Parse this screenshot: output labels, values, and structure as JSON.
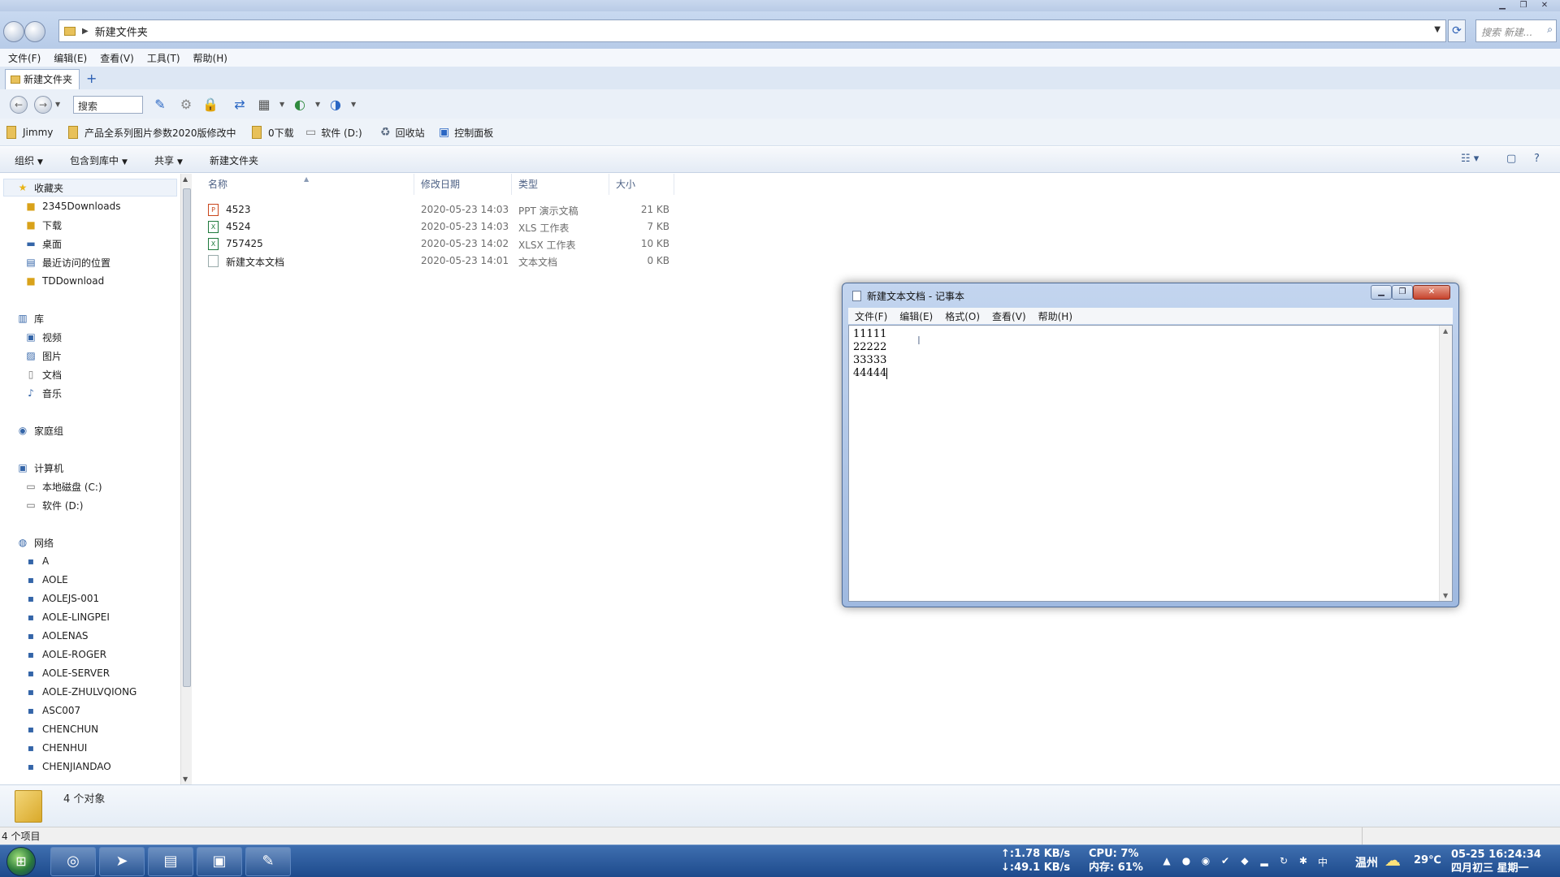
{
  "explorer": {
    "address_crumb": "新建文件夹",
    "search_placeholder": "搜索 新建...",
    "menu": [
      "文件(F)",
      "编辑(E)",
      "查看(V)",
      "工具(T)",
      "帮助(H)"
    ],
    "tab_label": "新建文件夹",
    "toolbar_search": "搜索",
    "favorites": [
      {
        "label": "Jimmy",
        "icon": "folder-icon"
      },
      {
        "label": "产品全系列图片参数2020版修改中",
        "icon": "folder-icon"
      },
      {
        "label": "0下载",
        "icon": "folder-icon"
      },
      {
        "label": "软件 (D:)",
        "icon": "drive-icon"
      },
      {
        "label": "回收站",
        "icon": "recycle-bin-icon"
      },
      {
        "label": "控制面板",
        "icon": "control-panel-icon"
      }
    ],
    "commands": [
      "组织",
      "包含到库中",
      "共享",
      "新建文件夹"
    ],
    "nav": {
      "favorites_header": "收藏夹",
      "favorites": [
        "2345Downloads",
        "下载",
        "桌面",
        "最近访问的位置",
        "TDDownload"
      ],
      "library_header": "库",
      "libraries": [
        "视频",
        "图片",
        "文档",
        "音乐"
      ],
      "homegroup": "家庭组",
      "computer_header": "计算机",
      "drives": [
        "本地磁盘 (C:)",
        "软件 (D:)"
      ],
      "network_header": "网络",
      "network": [
        "A",
        "AOLE",
        "AOLEJS-001",
        "AOLE-LINGPEI",
        "AOLENAS",
        "AOLE-ROGER",
        "AOLE-SERVER",
        "AOLE-ZHULVQIONG",
        "ASC007",
        "CHENCHUN",
        "CHENHUI",
        "CHENJIANDAO"
      ]
    },
    "columns": {
      "name": "名称",
      "modified": "修改日期",
      "type": "类型",
      "size": "大小"
    },
    "files": [
      {
        "name": "4523",
        "modified": "2020-05-23  14:03",
        "type": "PPT 演示文稿",
        "size": "21 KB",
        "icon": "ppt"
      },
      {
        "name": "4524",
        "modified": "2020-05-23  14:03",
        "type": "XLS 工作表",
        "size": "7 KB",
        "icon": "xls"
      },
      {
        "name": "757425",
        "modified": "2020-05-23  14:02",
        "type": "XLSX 工作表",
        "size": "10 KB",
        "icon": "xls"
      },
      {
        "name": "新建文本文档",
        "modified": "2020-05-23  14:01",
        "type": "文本文档",
        "size": "0 KB",
        "icon": "txt"
      }
    ],
    "details_count": "4 个对象",
    "status": "4 个项目"
  },
  "notepad": {
    "title": "新建文本文档 - 记事本",
    "menu": [
      "文件(F)",
      "编辑(E)",
      "格式(O)",
      "查看(V)",
      "帮助(H)"
    ],
    "lines": [
      "11111",
      "22222",
      "33333",
      "44444"
    ]
  },
  "taskbar": {
    "net_up": "↑:1.78 KB/s",
    "net_down": "↓:49.1 KB/s",
    "cpu": "CPU: 7%",
    "mem": "内存: 61%",
    "city": "温州",
    "temperature": "29℃",
    "date": "05-25",
    "time": "16:24:34",
    "lunar": "四月初三",
    "weekday": "星期一"
  },
  "colors": {
    "taskbar": "#2a5a9e",
    "explorer_chrome": "#c8d9f0",
    "notepad_frame": "#a8c0e4"
  }
}
